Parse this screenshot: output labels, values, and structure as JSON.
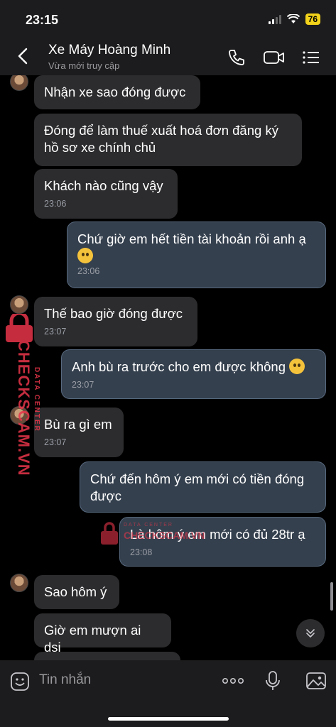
{
  "status_bar": {
    "time": "23:15",
    "battery": "76"
  },
  "header": {
    "contact_name": "Xe Máy Hoàng Minh",
    "contact_status": "Vừa mới truy cập"
  },
  "messages": [
    {
      "text": "Nhận xe sao đóng được",
      "time": ""
    },
    {
      "text": "Đóng để làm thuế xuất hoá đơn đăng ký hồ sơ xe chính chủ",
      "time": ""
    },
    {
      "text": "Khách nào cũng vậy",
      "time": "23:06"
    },
    {
      "text": "Chứ giờ em hết tiền tài khoản rồi anh ạ",
      "time": "23:06"
    },
    {
      "text": "Thế bao giờ đóng được",
      "time": "23:07"
    },
    {
      "text": "Anh bù ra trước cho em được không",
      "time": "23:07"
    },
    {
      "text": "Bù ra gì em",
      "time": "23:07"
    },
    {
      "text": "Chứ đến hôm ý em mới có tiền đóng được",
      "time": ""
    },
    {
      "text": "Là hôm ý em mới có đủ 28tr ạ",
      "time": "23:08"
    },
    {
      "text": "Sao hôm ý",
      "time": ""
    },
    {
      "text": "Giờ em mượn ai dsi",
      "time": ""
    }
  ],
  "watermark": {
    "line1": "DATA CENTER",
    "line2": "CHECKSCAM.VN"
  },
  "input": {
    "placeholder": "Tin nhắn"
  },
  "colors": {
    "incoming": "#2c2c2e",
    "outgoing": "#35404e",
    "watermark": "#e8364a",
    "battery": "#f2d21a"
  }
}
